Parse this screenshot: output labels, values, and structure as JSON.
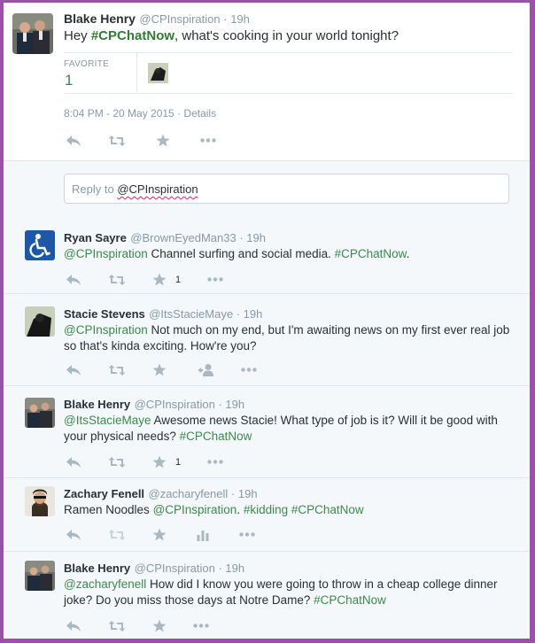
{
  "main_tweet": {
    "name": "Blake Henry",
    "handle": "@CPInspiration",
    "time": "19h",
    "text_prefix": "Hey ",
    "hashtag": "#CPChatNow",
    "text_suffix": ", what's cooking in your world tonight?",
    "favorite_label": "FAVORITE",
    "favorite_count": "1",
    "timestamp": "8:04 PM - 20 May 2015",
    "details_label": "Details"
  },
  "reply_box": {
    "prefix": "Reply to ",
    "mention": "@CPInspiration"
  },
  "replies": [
    {
      "name": "Ryan Sayre",
      "handle": "@BrownEyedMan33",
      "time": "19h",
      "mention": "@CPInspiration",
      "text": " Channel surfing and social media. ",
      "hashtag": "#CPChatNow",
      "tail": ".",
      "favorite_count": "1"
    },
    {
      "name": "Stacie Stevens",
      "handle": "@ItsStacieMaye",
      "time": "19h",
      "mention": "@CPInspiration",
      "text": " Not much on my end, but I'm awaiting news on my first ever real job so that's kinda exciting. How're you?"
    },
    {
      "name": "Blake Henry",
      "handle": "@CPInspiration",
      "time": "19h",
      "mention": "@ItsStacieMaye",
      "text": " Awesome news Stacie! What type of job is it? Will it be good with your physical needs? ",
      "hashtag": "#CPChatNow",
      "favorite_count": "1"
    },
    {
      "name": "Zachary Fenell",
      "handle": "@zacharyfenell",
      "time": "19h",
      "text_prefix": "Ramen Noodles ",
      "mention": "@CPInspiration",
      "text": ". ",
      "hashtag1": "#kidding",
      "space": " ",
      "hashtag2": "#CPChatNow"
    },
    {
      "name": "Blake Henry",
      "handle": "@CPInspiration",
      "time": "19h",
      "mention": "@zacharyfenell",
      "text": " How did I know you were going to throw in a cheap college dinner joke? Do you miss those days at Notre Dame? ",
      "hashtag": "#CPChatNow"
    }
  ],
  "separator": " · ",
  "icons": [
    "reply-icon",
    "retweet-icon",
    "favorite-icon",
    "more-icon",
    "follow-icon",
    "stats-icon"
  ],
  "colors": {
    "hashtag": "#3b8a4a",
    "border": "#9b51a8",
    "muted": "#8899a6",
    "icon": "#aab8c2"
  }
}
